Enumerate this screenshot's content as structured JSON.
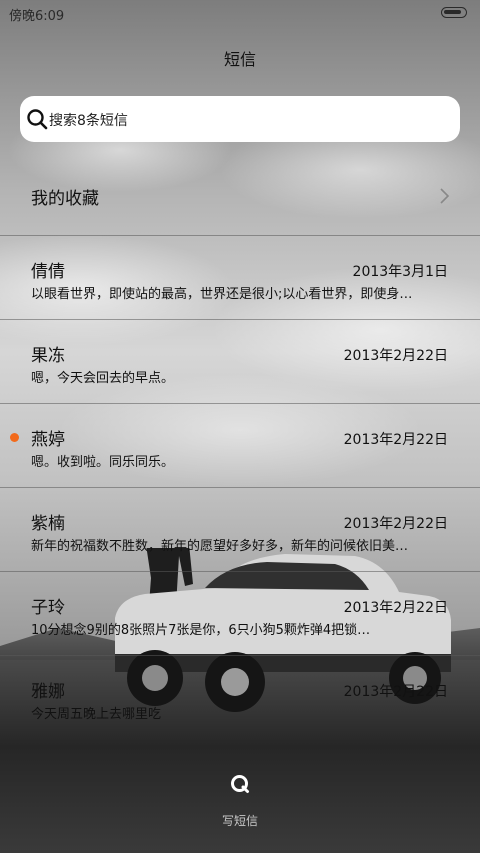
{
  "statusbar": {
    "time": "傍晚6:09",
    "battery_level": 0.9
  },
  "header": {
    "title": "短信"
  },
  "search": {
    "placeholder": "搜索8条短信"
  },
  "favorites": {
    "label": "我的收藏"
  },
  "conversations": [
    {
      "name": "倩倩",
      "date": "2013年3月1日",
      "preview": "以眼看世界，即使站的最高，世界还是很小;以心看世界，即使身…",
      "unread": false
    },
    {
      "name": "果冻",
      "date": "2013年2月22日",
      "preview": "嗯，今天会回去的早点。",
      "unread": false
    },
    {
      "name": "燕婷",
      "date": "2013年2月22日",
      "preview": "嗯。收到啦。同乐同乐。",
      "unread": true
    },
    {
      "name": "紫楠",
      "date": "2013年2月22日",
      "preview": "新年的祝福数不胜数，新年的愿望好多好多，新年的问候依旧美…",
      "unread": false
    },
    {
      "name": "子玲",
      "date": "2013年2月22日",
      "preview": "10分想念9别的8张照片7张是你，6只小狗5颗炸弹4把锁…",
      "unread": false
    },
    {
      "name": "雅娜",
      "date": "2013年2月22日",
      "preview": "今天周五晚上去哪里吃",
      "unread": false
    }
  ],
  "compose": {
    "label": "写短信"
  },
  "colors": {
    "unread_dot": "#f26a1b",
    "search_bg": "#ffffff"
  },
  "icons": {
    "search": "search-icon",
    "compose": "compose-icon",
    "chevron": "chevron-right-icon"
  }
}
